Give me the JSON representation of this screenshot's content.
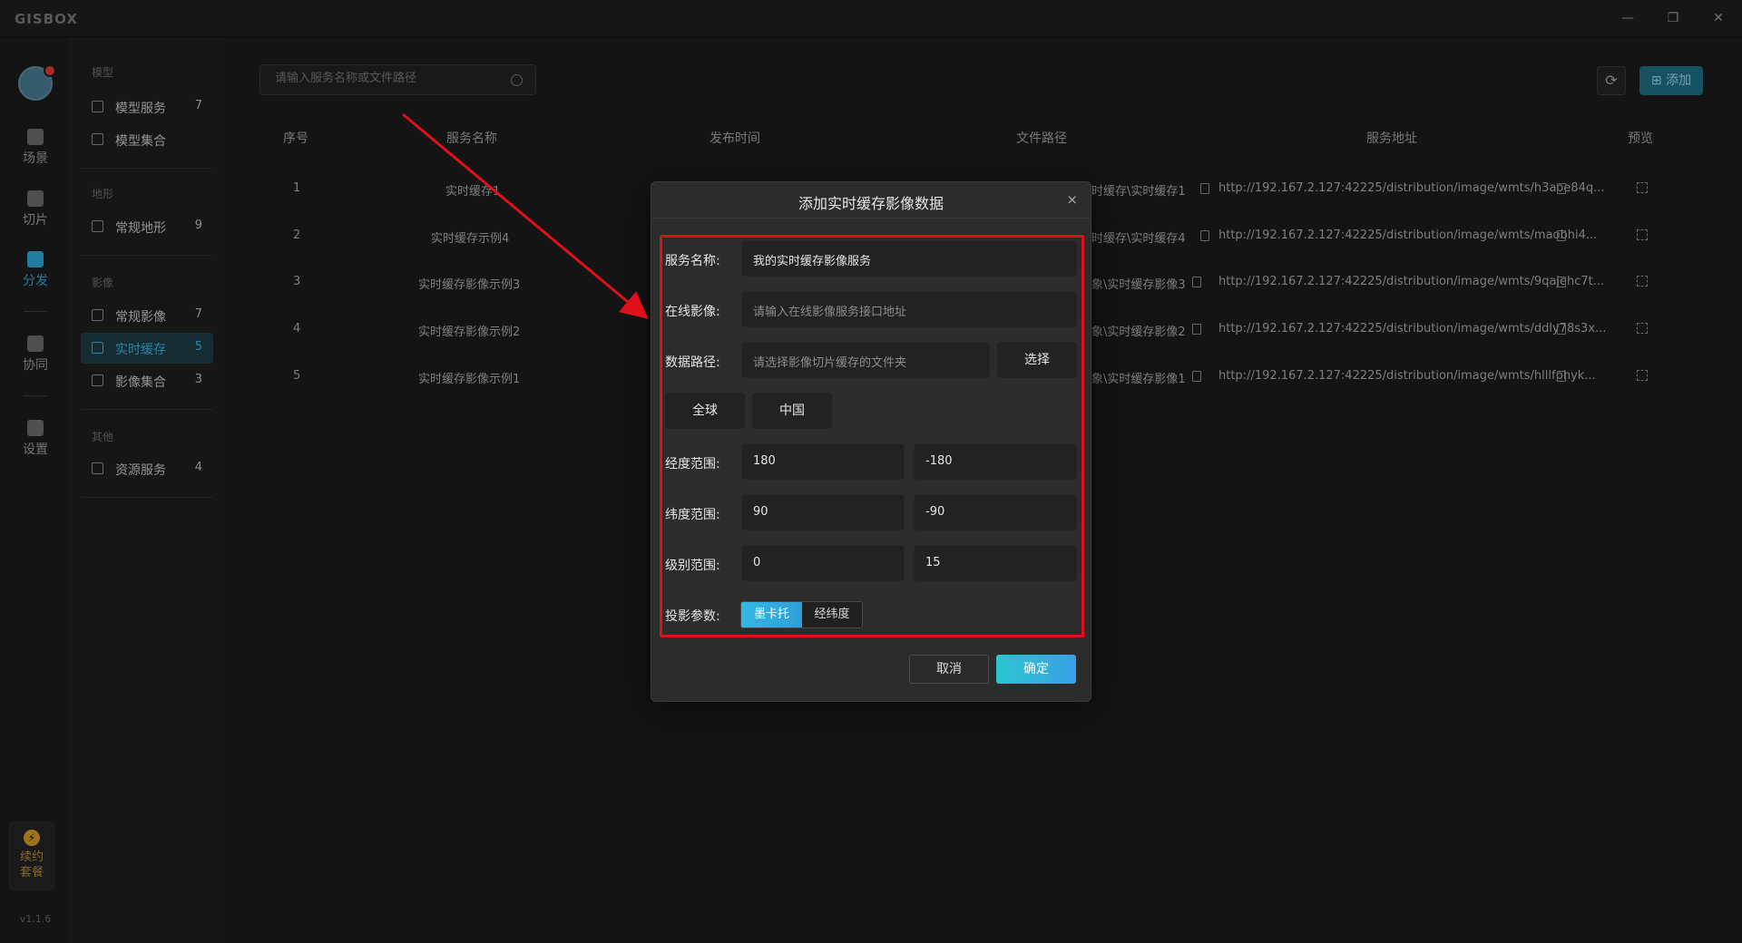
{
  "app": {
    "logo": "GISBOX",
    "version": "v1.1.6"
  },
  "window_controls": {
    "minimize": "—",
    "restore": "❐",
    "close": "✕"
  },
  "leftnav": {
    "items": [
      {
        "label": "场景",
        "icon": "scene-icon"
      },
      {
        "label": "切片",
        "icon": "slice-icon"
      },
      {
        "label": "分发",
        "icon": "distribute-icon",
        "active": true
      },
      {
        "label": "协同",
        "icon": "collab-icon"
      },
      {
        "label": "设置",
        "icon": "settings-icon"
      }
    ],
    "package": {
      "line1": "续约",
      "line2": "套餐",
      "icon": "⚡"
    }
  },
  "sidebar": {
    "sections": [
      {
        "title": "模型",
        "items": [
          {
            "label": "模型服务",
            "count": "7"
          },
          {
            "label": "模型集合",
            "count": ""
          }
        ]
      },
      {
        "title": "地形",
        "items": [
          {
            "label": "常规地形",
            "count": "9"
          }
        ]
      },
      {
        "title": "影像",
        "items": [
          {
            "label": "常规影像",
            "count": "7"
          },
          {
            "label": "实时缓存",
            "count": "5",
            "active": true
          },
          {
            "label": "影像集合",
            "count": "3"
          }
        ]
      },
      {
        "title": "其他",
        "items": [
          {
            "label": "资源服务",
            "count": "4"
          }
        ]
      }
    ]
  },
  "toolbar": {
    "search_placeholder": "请输入服务名称或文件路径",
    "add_label": "添加",
    "add_icon": "⊞",
    "refresh_icon": "⟳"
  },
  "table": {
    "headers": [
      "序号",
      "服务名称",
      "发布时间",
      "文件路径",
      "服务地址",
      "预览"
    ],
    "rows": [
      {
        "no": "1",
        "name": "实时缓存1",
        "path": "时缓存\\实时缓存1",
        "url": "http://192.167.2.127:42225/distribution/image/wmts/h3aoe84q..."
      },
      {
        "no": "2",
        "name": "实时缓存示例4",
        "path": "时缓存\\实时缓存4",
        "url": "http://192.167.2.127:42225/distribution/image/wmts/maobhi4..."
      },
      {
        "no": "3",
        "name": "实时缓存影像示例3",
        "path": "象\\实时缓存影像3",
        "url": "http://192.167.2.127:42225/distribution/image/wmts/9qajehc7t..."
      },
      {
        "no": "4",
        "name": "实时缓存影像示例2",
        "path": "象\\实时缓存影像2",
        "url": "http://192.167.2.127:42225/distribution/image/wmts/ddly78s3x..."
      },
      {
        "no": "5",
        "name": "实时缓存影像示例1",
        "path": "象\\实时缓存影像1",
        "url": "http://192.167.2.127:42225/distribution/image/wmts/hlllfphyk..."
      }
    ]
  },
  "dialog": {
    "title": "添加实时缓存影像数据",
    "close": "×",
    "service_name": {
      "label": "服务名称:",
      "value": "我的实时缓存影像服务"
    },
    "online_image": {
      "label": "在线影像:",
      "placeholder": "请输入在线影像服务接口地址"
    },
    "data_path": {
      "label": "数据路径:",
      "placeholder": "请选择影像切片缓存的文件夹",
      "button": "选择"
    },
    "presets": [
      "全球",
      "中国"
    ],
    "lon_range": {
      "label": "经度范围:",
      "min": "180",
      "max": "-180"
    },
    "lat_range": {
      "label": "纬度范围:",
      "min": "90",
      "max": "-90"
    },
    "level_range": {
      "label": "级别范围:",
      "min": "0",
      "max": "15"
    },
    "projection": {
      "label": "投影参数:",
      "options": [
        "墨卡托",
        "经纬度"
      ],
      "selected": "墨卡托"
    },
    "cancel": "取消",
    "confirm": "确定"
  },
  "colors": {
    "accent": "#2da7d6",
    "annotation": "#e0101a"
  }
}
